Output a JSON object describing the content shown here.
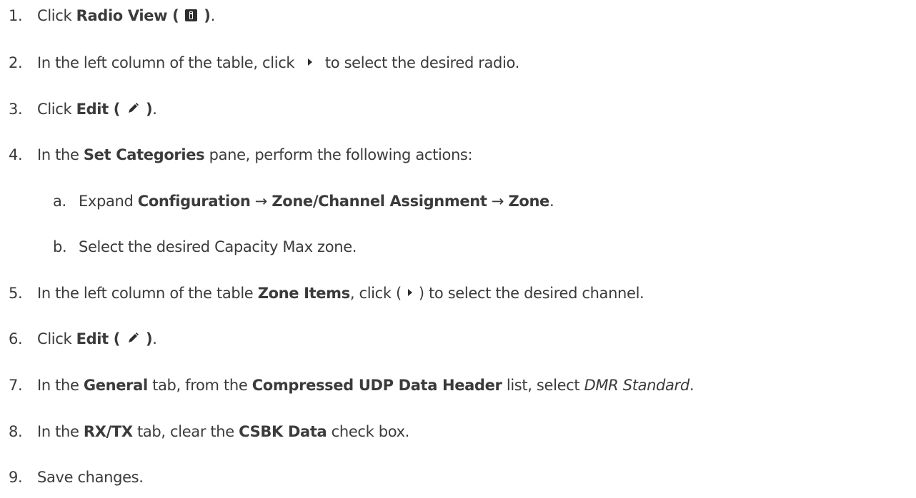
{
  "steps": [
    {
      "num": "1.",
      "t1": "Click ",
      "b1": "Radio View ( ",
      "b2": " )",
      "t2": "."
    },
    {
      "num": "2.",
      "t1": "In the left column of the table, click ",
      "t2": " to select the desired radio."
    },
    {
      "num": "3.",
      "t1": "Click ",
      "b1": "Edit ( ",
      "b2": " )",
      "t2": "."
    },
    {
      "num": "4.",
      "t1": "In the ",
      "b1": "Set Categories",
      "t2": " pane, perform the following actions:"
    },
    {
      "num": "a.",
      "t1": "Expand ",
      "b1": "Configuration",
      "t2": " → ",
      "b2": "Zone/Channel Assignment",
      "t3": " → ",
      "b3": "Zone",
      "t4": "."
    },
    {
      "num": "b.",
      "t1": "Select the desired Capacity Max zone."
    },
    {
      "num": "5.",
      "t1": "In the left column of the table ",
      "b1": "Zone Items",
      "t2": ", click (",
      "t3": ") to select the desired channel."
    },
    {
      "num": "6.",
      "t1": "Click ",
      "b1": "Edit ( ",
      "b2": " )",
      "t2": "."
    },
    {
      "num": "7.",
      "t1": "In the ",
      "b1": "General",
      "t2": " tab, from the ",
      "b2": "Compressed UDP Data Header",
      "t3": " list, select ",
      "i1": "DMR Standard",
      "t4": "."
    },
    {
      "num": "8.",
      "t1": "In the ",
      "b1": "RX/TX",
      "t2": " tab, clear the ",
      "b2": "CSBK Data",
      "t3": " check box."
    },
    {
      "num": "9.",
      "t1": "Save changes."
    }
  ],
  "icons": {
    "radio_view": "radio-device-icon",
    "edit": "pencil-icon",
    "select": "triangle-right-icon"
  }
}
